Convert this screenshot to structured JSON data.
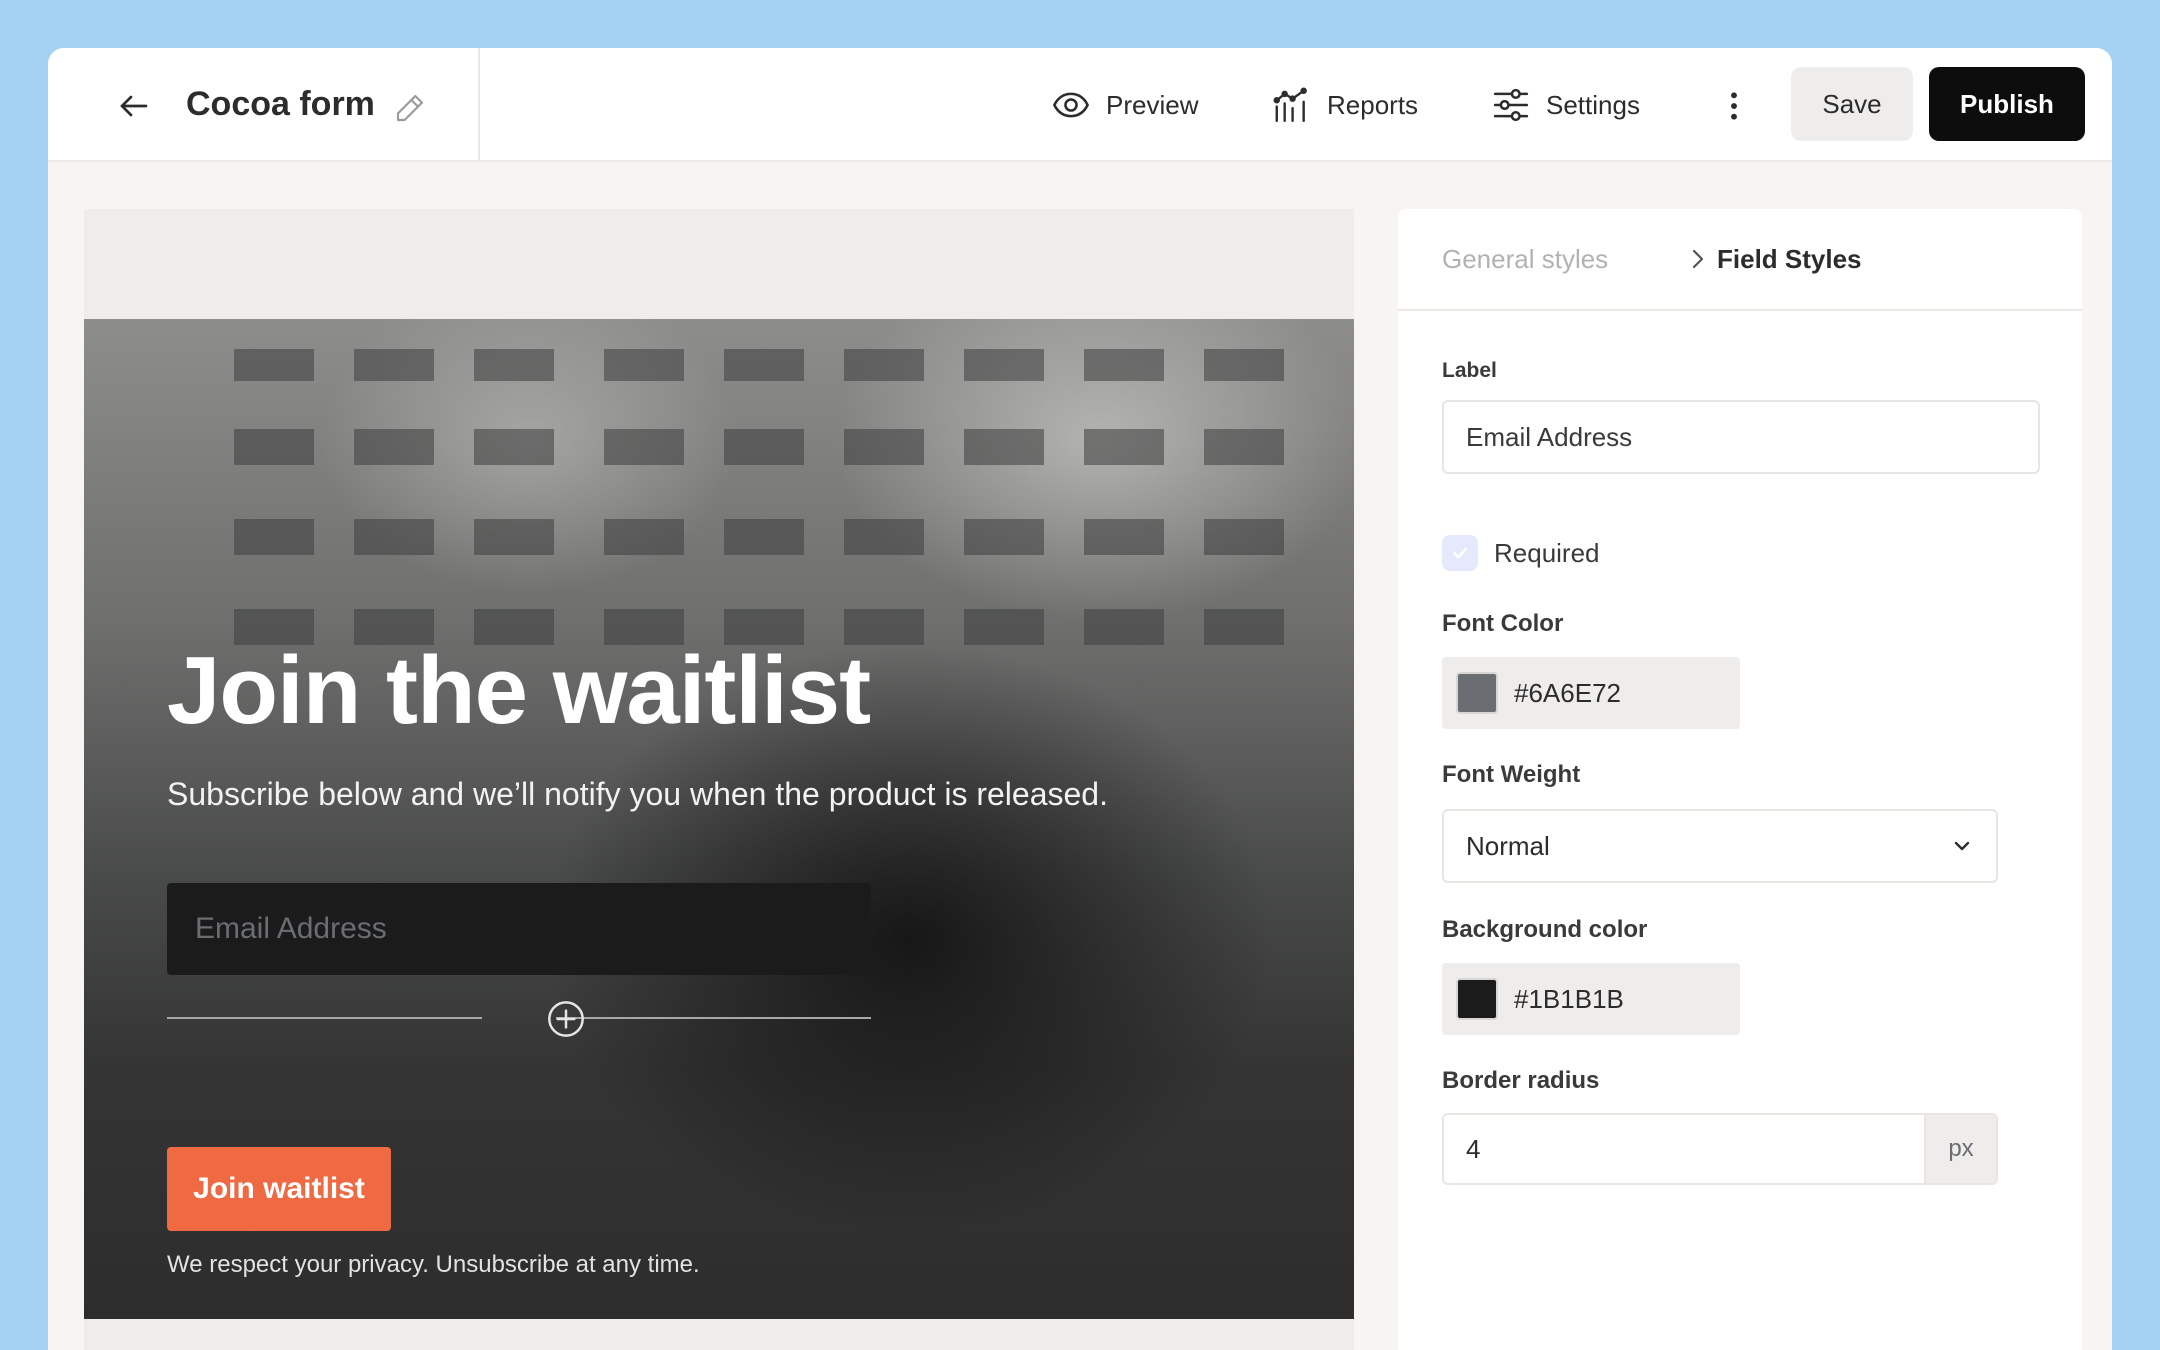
{
  "header": {
    "form_title": "Cocoa form",
    "nav": [
      {
        "label": "Preview",
        "icon": "eye-icon"
      },
      {
        "label": "Reports",
        "icon": "chart-icon"
      },
      {
        "label": "Settings",
        "icon": "sliders-icon"
      }
    ],
    "save_label": "Save",
    "publish_label": "Publish"
  },
  "preview": {
    "title": "Join the waitlist",
    "subtitle": "Subscribe below and we’ll notify you when the product is released.",
    "email_placeholder": "Email Address",
    "button_label": "Join waitlist",
    "privacy_note": "We respect your privacy. Unsubscribe at any time.",
    "button_color": "#ef6a43"
  },
  "panel": {
    "breadcrumb": {
      "parent": "General styles",
      "current": "Field Styles"
    },
    "label_section": {
      "heading": "Label",
      "value": "Email Address"
    },
    "required": {
      "label": "Required",
      "checked": true
    },
    "font_color": {
      "heading": "Font Color",
      "value": "#6A6E72",
      "swatch": "#6A6E72"
    },
    "font_weight": {
      "heading": "Font Weight",
      "value": "Normal"
    },
    "background_color": {
      "heading": "Background color",
      "value": "#1B1B1B",
      "swatch": "#1B1B1B"
    },
    "border_radius": {
      "heading": "Border radius",
      "value": "4",
      "unit": "px"
    }
  },
  "colors": {
    "background": "#a5d2f3",
    "accent_dark": "#0d0d0d",
    "panel_bg": "#ffffff",
    "canvas_bg": "#efedec"
  }
}
